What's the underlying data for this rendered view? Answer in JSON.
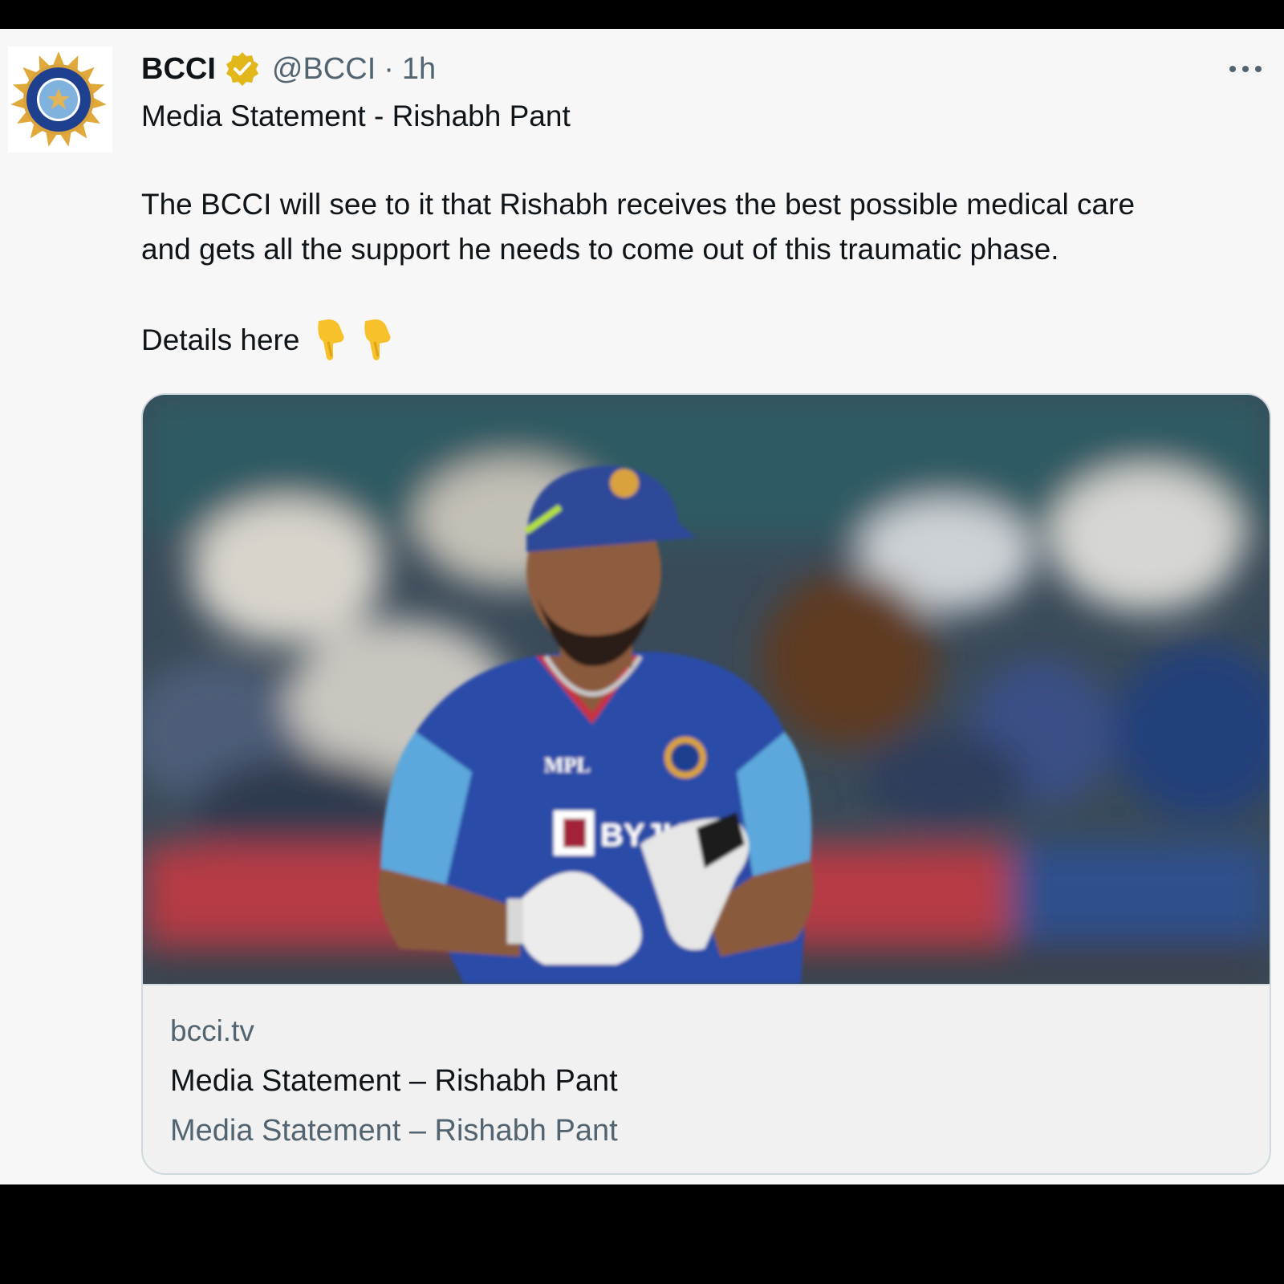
{
  "tweet": {
    "author_name": "BCCI",
    "handle": "@BCCI",
    "separator": "·",
    "time": "1h",
    "line1": "Media Statement - Rishabh Pant",
    "line2": "The BCCI will see to it that Rishabh receives the best possible medical care",
    "line3": "and gets all the support he needs to come out of this traumatic phase.",
    "line4": "Details here",
    "emojis": [
      "backhand-index-pointing-down-icon",
      "backhand-index-pointing-down-icon"
    ]
  },
  "card": {
    "domain": "bcci.tv",
    "title": "Media Statement – Rishabh Pant",
    "description": "Media Statement – Rishabh Pant",
    "jersey_sponsor": "MPL",
    "jersey_main_sponsor": "BYJU'S"
  },
  "colors": {
    "background": "#f7f7f7",
    "verified_badge": "#e2b719",
    "secondary_text": "#536471",
    "jersey_blue": "#2a4ca8",
    "sleeve_blue": "#5ba7dc"
  }
}
